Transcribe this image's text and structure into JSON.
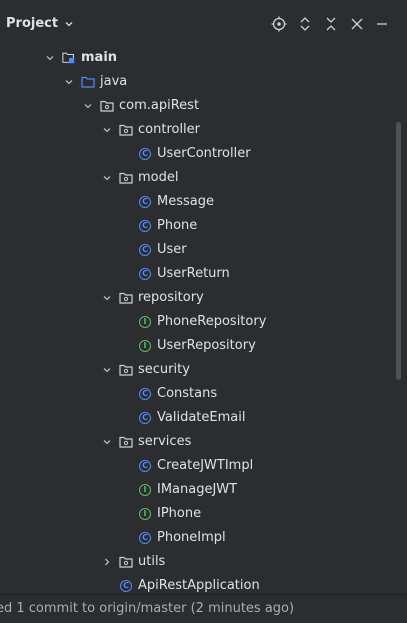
{
  "header": {
    "title": "Project",
    "tools": [
      "locate-icon",
      "expand-collapse-icon",
      "collapse-all-icon",
      "close-icon",
      "minimize-icon"
    ]
  },
  "tree": [
    {
      "label": "main",
      "type": "source-folder",
      "expanded": true,
      "depth": 0,
      "bold": true
    },
    {
      "label": "java",
      "type": "folder",
      "expanded": true,
      "depth": 1
    },
    {
      "label": "com.apiRest",
      "type": "package",
      "expanded": true,
      "depth": 2
    },
    {
      "label": "controller",
      "type": "package",
      "expanded": true,
      "depth": 3
    },
    {
      "label": "UserController",
      "type": "class",
      "depth": 4
    },
    {
      "label": "model",
      "type": "package",
      "expanded": true,
      "depth": 3
    },
    {
      "label": "Message",
      "type": "class",
      "depth": 4
    },
    {
      "label": "Phone",
      "type": "class",
      "depth": 4
    },
    {
      "label": "User",
      "type": "class",
      "depth": 4
    },
    {
      "label": "UserReturn",
      "type": "class",
      "depth": 4
    },
    {
      "label": "repository",
      "type": "package",
      "expanded": true,
      "depth": 3
    },
    {
      "label": "PhoneRepository",
      "type": "interface",
      "depth": 4
    },
    {
      "label": "UserRepository",
      "type": "interface",
      "depth": 4
    },
    {
      "label": "security",
      "type": "package",
      "expanded": true,
      "depth": 3
    },
    {
      "label": "Constans",
      "type": "class",
      "depth": 4
    },
    {
      "label": "ValidateEmail",
      "type": "class",
      "depth": 4
    },
    {
      "label": "services",
      "type": "package",
      "expanded": true,
      "depth": 3
    },
    {
      "label": "CreateJWTImpl",
      "type": "class",
      "depth": 4
    },
    {
      "label": "IManageJWT",
      "type": "interface",
      "depth": 4
    },
    {
      "label": "IPhone",
      "type": "interface",
      "depth": 4
    },
    {
      "label": "PhoneImpl",
      "type": "class",
      "depth": 4
    },
    {
      "label": "utils",
      "type": "package",
      "expanded": false,
      "depth": 3
    },
    {
      "label": "ApiRestApplication",
      "type": "class",
      "depth": 3
    }
  ],
  "status": {
    "text": "ed 1 commit to origin/master (2 minutes ago)"
  },
  "colors": {
    "background": "#2b2d30",
    "class_icon": "#548af7",
    "interface_icon": "#5fb865",
    "text": "#dfe1e5"
  }
}
